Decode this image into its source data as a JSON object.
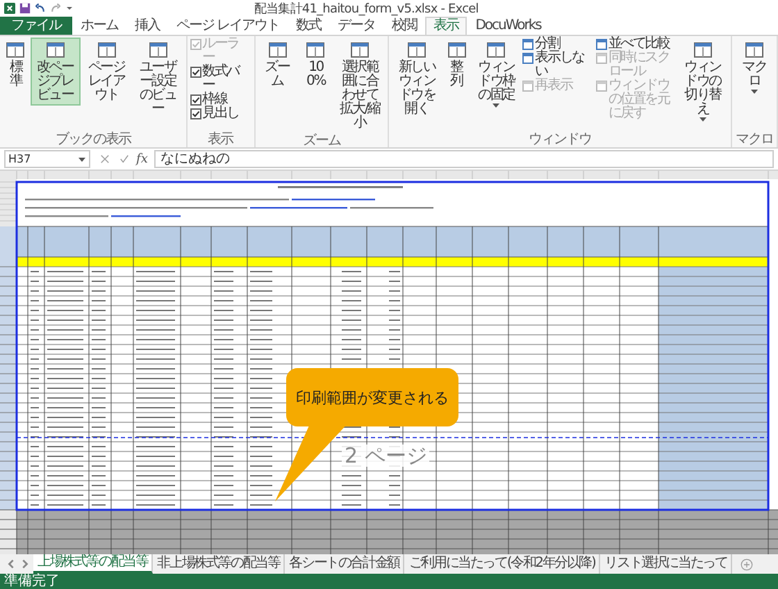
{
  "window": {
    "title": "配当集計41_haitou_form_v5.xlsx - Excel"
  },
  "ribbon_tabs": [
    {
      "label": "ファイル",
      "kind": "file",
      "selected": false
    },
    {
      "label": "ホーム",
      "kind": "tab",
      "selected": false
    },
    {
      "label": "挿入",
      "kind": "tab",
      "selected": false
    },
    {
      "label": "ページ レイアウト",
      "kind": "tab",
      "selected": false
    },
    {
      "label": "数式",
      "kind": "tab",
      "selected": false
    },
    {
      "label": "データ",
      "kind": "tab",
      "selected": false
    },
    {
      "label": "校閲",
      "kind": "tab",
      "selected": false
    },
    {
      "label": "表示",
      "kind": "tab",
      "selected": true
    },
    {
      "label": "DocuWorks",
      "kind": "tab",
      "selected": false
    }
  ],
  "ribbon_groups": [
    {
      "label": "ブックの表示",
      "items": [
        {
          "kind": "large",
          "label": "標準",
          "selected": false,
          "has_menu": false
        },
        {
          "kind": "large",
          "label": "改ページプレビュー",
          "selected": true,
          "has_menu": false
        },
        {
          "kind": "large",
          "label": "ページレイアウト",
          "selected": false,
          "has_menu": false
        },
        {
          "kind": "large",
          "label": "ユーザー設定のビュー",
          "selected": false,
          "has_menu": false
        }
      ]
    },
    {
      "label": "表示",
      "items": [
        {
          "kind": "checks",
          "items": [
            {
              "label": "ルーラー",
              "checked": true,
              "disabled": true
            },
            {
              "label": "数式バー",
              "checked": true,
              "disabled": false
            },
            {
              "label": "枠線",
              "checked": true,
              "disabled": false
            },
            {
              "label": "見出し",
              "checked": true,
              "disabled": false
            }
          ]
        }
      ]
    },
    {
      "label": "ズーム",
      "items": [
        {
          "kind": "large",
          "label": "ズーム",
          "selected": false,
          "has_menu": false
        },
        {
          "kind": "large",
          "label": "100%",
          "selected": false,
          "has_menu": false
        },
        {
          "kind": "large",
          "label": "選択範囲に合わせて拡大/縮小",
          "selected": false,
          "has_menu": false
        }
      ]
    },
    {
      "label": "ウィンドウ",
      "items": [
        {
          "kind": "large",
          "label": "新しいウィンドウを開く",
          "selected": false,
          "has_menu": false
        },
        {
          "kind": "large",
          "label": "整列",
          "selected": false,
          "has_menu": false
        },
        {
          "kind": "large",
          "label": "ウィンドウ枠の固定",
          "selected": false,
          "has_menu": true
        },
        {
          "kind": "stack",
          "items": [
            {
              "label": "分割",
              "disabled": false
            },
            {
              "label": "表示しない",
              "disabled": false
            },
            {
              "label": "再表示",
              "disabled": true
            }
          ]
        },
        {
          "kind": "stack",
          "items": [
            {
              "label": "並べて比較",
              "disabled": false
            },
            {
              "label": "同時にスクロール",
              "disabled": true
            },
            {
              "label": "ウィンドウの位置を元に戻す",
              "disabled": true
            }
          ]
        },
        {
          "kind": "large",
          "label": "ウィンドウの切り替え",
          "selected": false,
          "has_menu": true
        }
      ]
    },
    {
      "label": "マクロ",
      "items": [
        {
          "kind": "large",
          "label": "マクロ",
          "selected": false,
          "has_menu": true
        }
      ]
    }
  ],
  "formula_bar": {
    "name_box": "H37",
    "function_label": "fx",
    "value": "なにぬねの"
  },
  "sheet": {
    "page_label": "2 ページ"
  },
  "callout": {
    "text": "印刷範囲が変更される"
  },
  "sheet_tabs": [
    {
      "label": "上場株式等の配当等",
      "selected": true
    },
    {
      "label": "非上場株式等の配当等",
      "selected": false
    },
    {
      "label": "各シートの合計金額",
      "selected": false
    },
    {
      "label": "ご利用に当たって(令和2年分以降)",
      "selected": false
    },
    {
      "label": "リスト選択に当たって",
      "selected": false
    }
  ],
  "status_bar": {
    "text": "準備完了"
  }
}
